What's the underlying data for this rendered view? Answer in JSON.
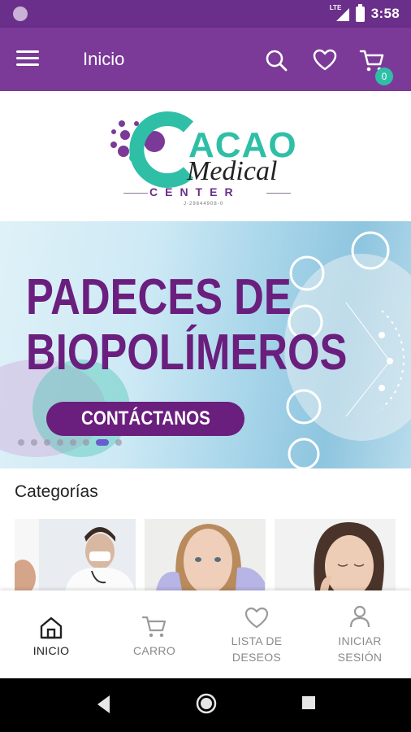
{
  "status_bar": {
    "time": "3:58",
    "network": "LTE"
  },
  "app_bar": {
    "title": "Inicio",
    "cart_count": "0",
    "icons": [
      "menu-icon",
      "search-icon",
      "heart-icon",
      "cart-icon"
    ]
  },
  "logo": {
    "brand_main": "ACAO",
    "brand_script": "Medical",
    "brand_center": "CENTER",
    "brand_id": "J-29844908-0"
  },
  "banner": {
    "line1": "PADECES DE",
    "line2": "BIOPOLÍMEROS",
    "cta_label": "CONTÁCTANOS",
    "slide_count": 8,
    "active_slide": 6
  },
  "categories": {
    "title": "Categorías"
  },
  "bottom_nav": {
    "items": [
      {
        "label": "INICIO",
        "icon": "home-icon",
        "active": true
      },
      {
        "label": "CARRO",
        "icon": "cart-icon",
        "active": false
      },
      {
        "label_line1": "LISTA DE",
        "label_line2": "DESEOS",
        "icon": "heart-icon",
        "active": false
      },
      {
        "label_line1": "INICIAR",
        "label_line2": "SESIÓN",
        "icon": "user-icon",
        "active": false
      }
    ]
  },
  "colors": {
    "primary": "#7b3a98",
    "status_bar": "#6a2f8a",
    "accent_teal": "#2fbfa6",
    "banner_text": "#6a1e7d"
  }
}
